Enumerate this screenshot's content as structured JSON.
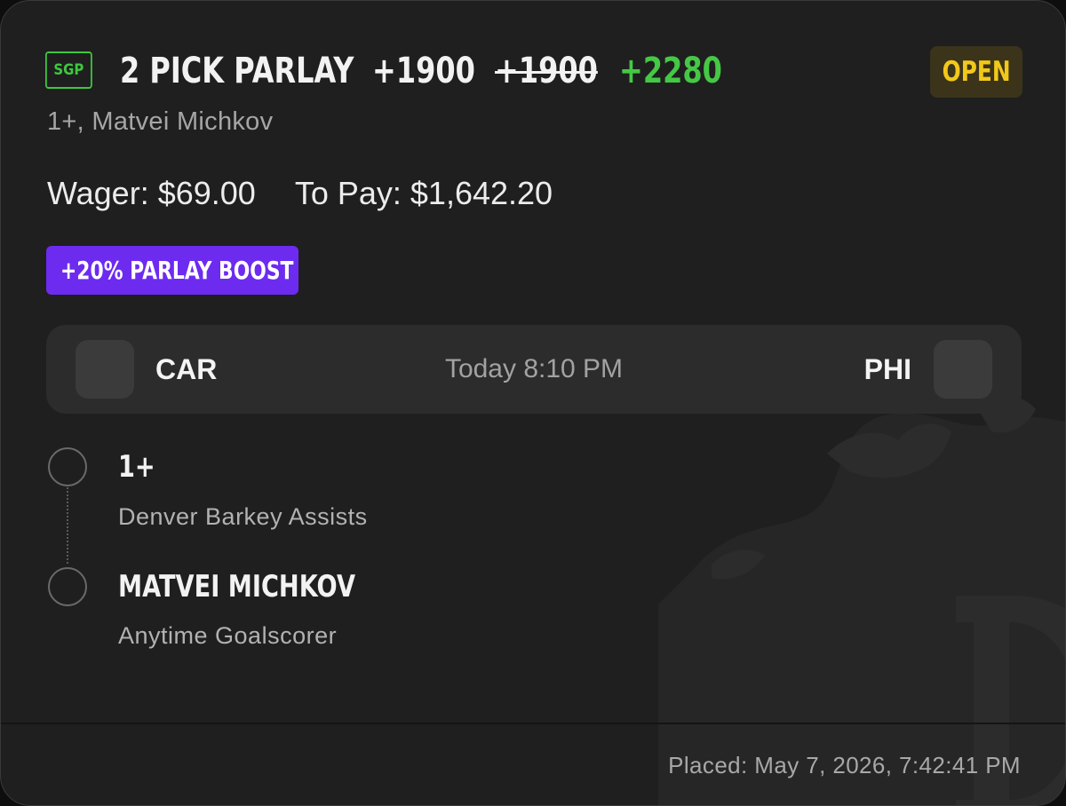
{
  "bet": {
    "badge": "SGP",
    "title": "2 PICK PARLAY",
    "odds": "+1900",
    "original_odds": "+1900",
    "boosted_odds": "+2280",
    "status": "OPEN",
    "subtitle": "1+, Matvei Michkov",
    "wager_label": "Wager:",
    "wager": "$69.00",
    "to_pay_label": "To Pay:",
    "to_pay": "$1,642.20",
    "boost_label": "+20% PARLAY BOOST"
  },
  "game": {
    "away_team": "CAR",
    "home_team": "PHI",
    "time": "Today 8:10 PM"
  },
  "legs": [
    {
      "title": "1+",
      "description": "Denver Barkey Assists"
    },
    {
      "title": "MATVEI MICHKOV",
      "description": "Anytime Goalscorer"
    }
  ],
  "footer": {
    "placed": "Placed: May 7, 2026, 7:42:41 PM"
  },
  "colors": {
    "card_bg": "#1f1f1f",
    "accent_green": "#45c845",
    "open_badge_text": "#f2c81a",
    "open_badge_bg": "#3b341a",
    "boost_purple": "#6d2bf0"
  },
  "icons": {
    "watermark": "crown-d-logo-icon",
    "leg_marker": "circle-outline-icon"
  }
}
